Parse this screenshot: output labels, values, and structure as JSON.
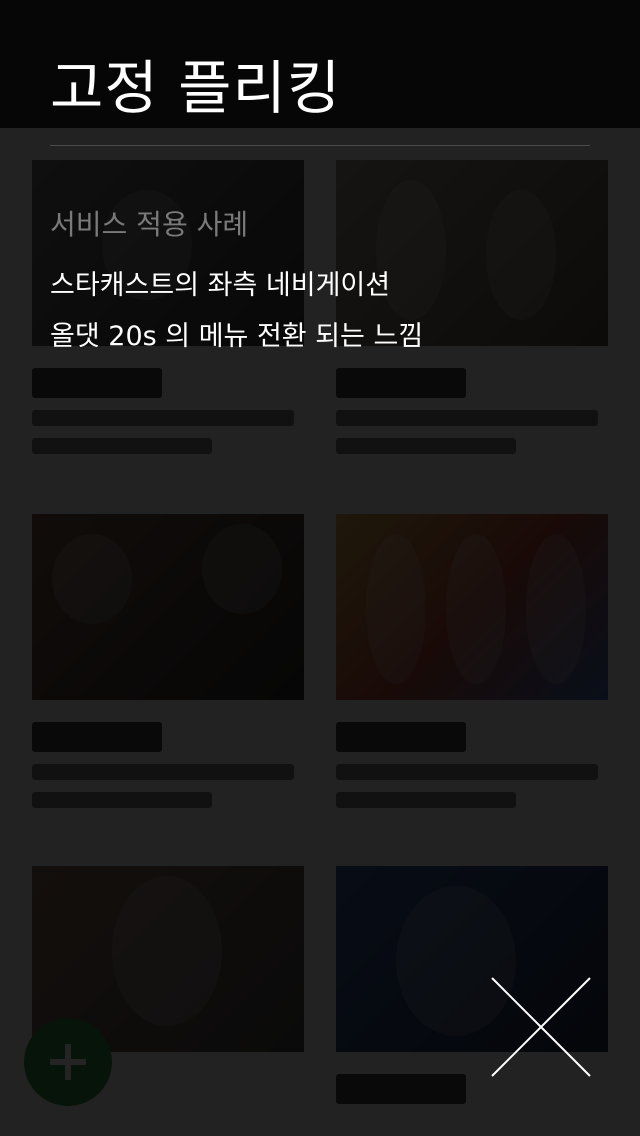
{
  "background": {
    "header_title": "",
    "cards": [
      {
        "title": "",
        "thumb": "thumb-a"
      },
      {
        "title": "",
        "thumb": "thumb-f"
      },
      {
        "title": "",
        "thumb": "thumb-c"
      },
      {
        "title": "",
        "thumb": "thumb-b"
      },
      {
        "title": "",
        "thumb": "thumb-e"
      },
      {
        "title": "",
        "thumb": "thumb-d"
      }
    ],
    "fab_icon": "plus-icon",
    "fab_color": "#2f8f4c"
  },
  "overlay": {
    "title": "고정 플리킹",
    "subtitle": "서비스 적용 사례",
    "lines": [
      "스타캐스트의 좌측 네비게이션",
      "올댓 20s 의 메뉴 전환 되는 느낌"
    ],
    "close_icon": "close-icon",
    "colors": {
      "title": "#ffffff",
      "subtitle": "#7a7a7a",
      "divider": "#4a4a4a"
    }
  }
}
